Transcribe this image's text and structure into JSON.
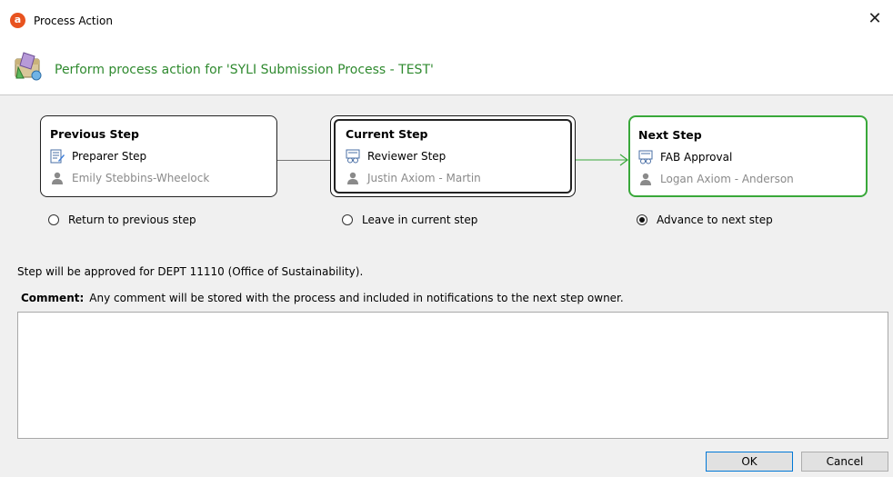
{
  "window": {
    "title": "Process Action",
    "app_icon_letter": "a",
    "close_glyph": "✕"
  },
  "header": {
    "text": "Perform process action for 'SYLI Submission Process - TEST'"
  },
  "steps": {
    "previous": {
      "heading": "Previous Step",
      "step_name": "Preparer Step",
      "owner": "Emily Stebbins-Wheelock",
      "option_label": "Return to previous step",
      "selected": false
    },
    "current": {
      "heading": "Current Step",
      "step_name": "Reviewer Step",
      "owner": "Justin Axiom - Martin",
      "option_label": "Leave in current step",
      "selected": false
    },
    "next": {
      "heading": "Next Step",
      "step_name": "FAB Approval",
      "owner": "Logan Axiom - Anderson",
      "option_label": "Advance to next step",
      "selected": true
    }
  },
  "approval_note": "Step will be approved for DEPT 11110 (Office of Sustainability).",
  "comment": {
    "label": "Comment:",
    "hint": "Any comment will be stored with the process and included in notifications to the next step owner.",
    "value": ""
  },
  "buttons": {
    "ok": "OK",
    "cancel": "Cancel"
  },
  "colors": {
    "accent_green": "#39a83a",
    "header_text": "#2f8a2f",
    "ok_border": "#0078d7"
  }
}
